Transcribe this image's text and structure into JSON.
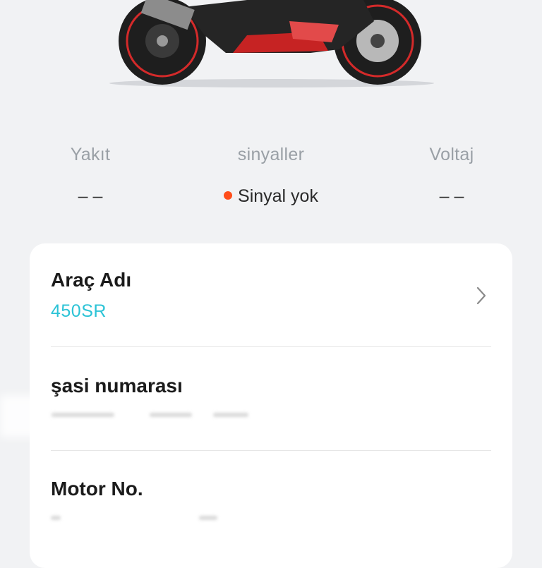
{
  "vehicle_image": {
    "icon": "motorcycle-image"
  },
  "stats": {
    "fuel": {
      "label": "Yakıt",
      "value": "– –"
    },
    "signal": {
      "label": "sinyaller",
      "value": "Sinyal yok",
      "status_color": "#ff4d1a"
    },
    "voltage": {
      "label": "Voltaj",
      "value": "– –"
    }
  },
  "info_card": {
    "vehicle_name": {
      "label": "Araç Adı",
      "value": "450SR",
      "value_color": "#2bc3d6",
      "icon": "chevron-right-icon"
    },
    "chassis_number": {
      "label": "şasi numarası"
    },
    "engine_number": {
      "label": "Motor No."
    }
  }
}
